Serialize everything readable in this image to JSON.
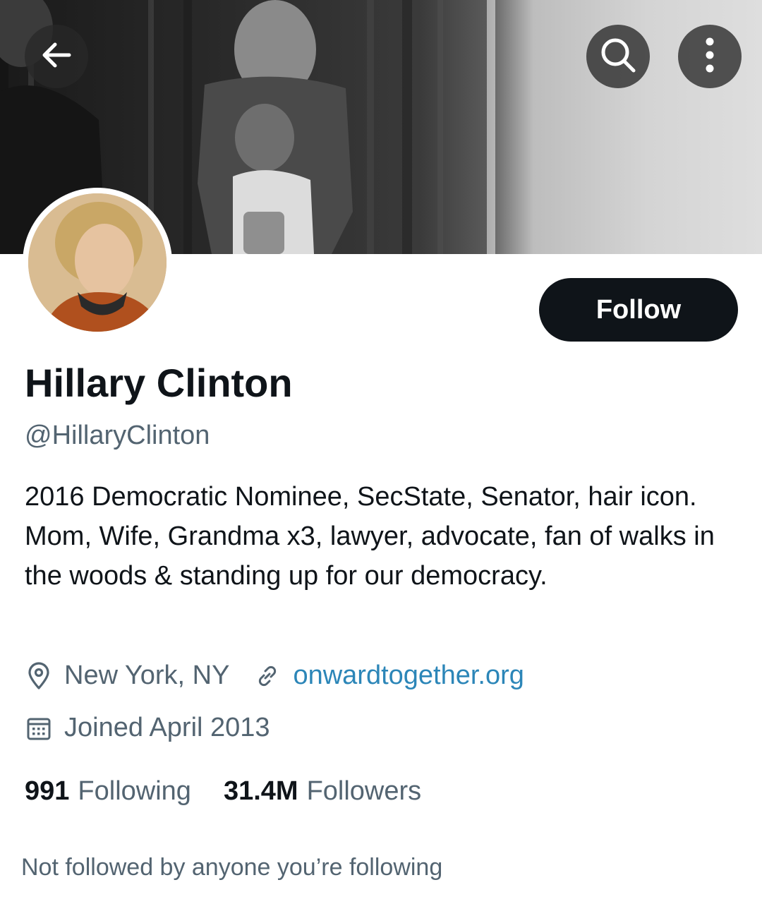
{
  "header": {
    "back_icon": "arrow-left-icon",
    "search_icon": "search-icon",
    "more_icon": "more-vertical-icon"
  },
  "profile": {
    "display_name": "Hillary Clinton",
    "handle": "@HillaryClinton",
    "follow_label": "Follow",
    "bio": "2016 Democratic Nominee, SecState, Senator, hair icon. Mom, Wife, Grandma x3, lawyer, advocate, fan of walks in the woods & standing up for our democracy.",
    "location": "New York, NY",
    "website": "onwardtogether.org",
    "joined": "Joined April 2013"
  },
  "stats": {
    "following_count": "991",
    "following_label": "Following",
    "followers_count": "31.4M",
    "followers_label": "Followers"
  },
  "social_context": "Not followed by anyone you’re following",
  "colors": {
    "text_primary": "#0f1419",
    "text_secondary": "#536471",
    "link": "#2c86b8",
    "follow_button": "#0f1419"
  }
}
